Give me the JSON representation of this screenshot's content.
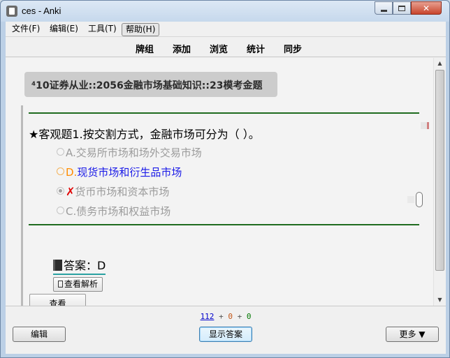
{
  "window": {
    "title": "ces - Anki",
    "close_glyph": "✕"
  },
  "menu": [
    "文件(F)",
    "编辑(E)",
    "工具(T)",
    "帮助(H)"
  ],
  "toolbar": [
    "牌组",
    "添加",
    "浏览",
    "统计",
    "同步"
  ],
  "card": {
    "deck_path": "⁴10证券从业::2056金融市场基础知识::23模考金题",
    "question": "★客观题1.按交割方式，金融市场可分为（ ）。",
    "options": [
      {
        "letter": "A.",
        "text": "交易所市场和场外交易市场",
        "state": "neutral"
      },
      {
        "letter": "D.",
        "text": "现货市场和衍生品市场",
        "state": "correct"
      },
      {
        "letter": "✗",
        "text": "货币市场和资本市场",
        "state": "wrong"
      },
      {
        "letter": "C.",
        "text": "债务市场和权益市场",
        "state": "neutral"
      }
    ],
    "answer": "答案：D",
    "analysis_button": "查看解析",
    "view_button": "查看"
  },
  "scrollbar": {
    "up_glyph": "▲",
    "down_glyph": "▼"
  },
  "status": {
    "new_count": "112",
    "learn_count": "0",
    "review_count": "0",
    "separator": "+"
  },
  "bottom": {
    "edit_label": "编辑",
    "show_answer_label": "显示答案",
    "more_label": "更多 ▼"
  },
  "colors": {
    "correct_letter": "#ff8c00",
    "correct_text": "#1a1ae8",
    "wrong_mark": "#e00000",
    "rule": "#1f6b1f"
  }
}
